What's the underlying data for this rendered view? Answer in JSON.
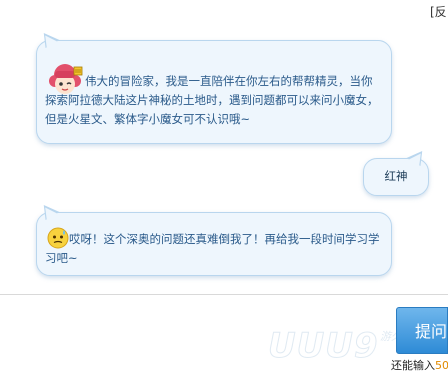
{
  "header": {
    "feedback_label": "[反"
  },
  "messages": [
    {
      "sender": "bot",
      "avatar": "mascot-girl",
      "text": "伟大的冒险家，我是一直陪伴在你左右的帮帮精灵，当你探索阿拉德大陆这片神秘的土地时，遇到问题都可以来问小魔女，但是火星文、繁体字小魔女可不认识哦~"
    },
    {
      "sender": "user",
      "text": "红神"
    },
    {
      "sender": "bot",
      "avatar": "sweat-emoji",
      "text": "哎呀！这个深奥的问题还真难倒我了！再给我一段时间学习学习吧~"
    }
  ],
  "input": {
    "value": "",
    "placeholder": ""
  },
  "ask_button": {
    "label": "提问"
  },
  "remaining": {
    "prefix": "还能输入",
    "count": "50"
  },
  "watermark": {
    "text": "UUU9",
    "subtext": "游久网"
  },
  "colors": {
    "bubble_bg": "#eef6fd",
    "bubble_border": "#b9d6ee",
    "button": "#3b94db",
    "count": "#e08a00"
  }
}
